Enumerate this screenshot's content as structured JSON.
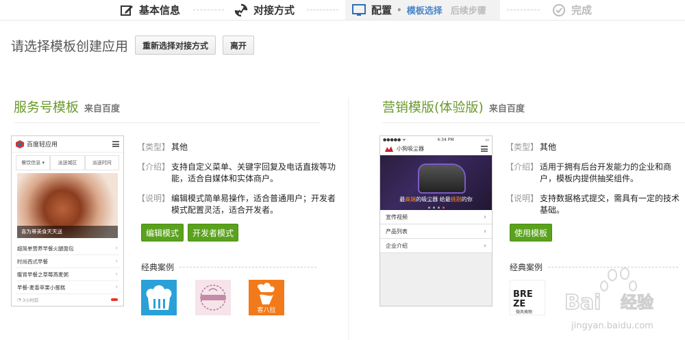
{
  "steps": {
    "s1": "基本信息",
    "s2": "对接方式",
    "s3": "配置",
    "s3_sub_active": "模板选择",
    "s3_sub_next": "后续步骤",
    "s4": "完成"
  },
  "toolbar": {
    "prompt": "请选择模板创建应用",
    "reselect_label": "重新选择对接方式",
    "leave_label": "离开"
  },
  "left": {
    "name": "服务号模板",
    "source": "来自百度",
    "phone": {
      "title": "百度轻应用",
      "tabs": [
        "餐饮信息 ▾",
        "派送城区",
        "派送时间"
      ],
      "hero_caption": "喜为尊美食天天送",
      "items": [
        "超简单营养早餐火腿面包",
        "时尚西式早餐",
        "暖胃早餐之草莓燕麦粥",
        "早餐-麦香苹果小蛋糕"
      ],
      "footer": "3小时前"
    },
    "type_label": "【类型】",
    "type_value": "其他",
    "intro_label": "【介绍】",
    "intro_value": "支持自定义菜单、关键字回复及电话直拨等功能，适合自媒体和实体商户。",
    "note_label": "【说明】",
    "note_value": "编辑模式简单易操作，适合普通用户；开发者模式配置灵活，适合开发者。",
    "edit_label": "编辑模式",
    "dev_label": "开发者模式",
    "cases_label": "经典案例",
    "case3_text": "客八拉"
  },
  "right": {
    "name": "营销模版(体验版)",
    "source": "来自百度",
    "phone": {
      "status_left": "●●●●● ᯤ",
      "status_time": "4:34 PM",
      "title": "小狗吸尘器",
      "hero_caption_a": "最",
      "hero_caption_b": "高端",
      "hero_caption_c": "的吸尘器 给最",
      "hero_caption_d": "挑剔",
      "hero_caption_e": "的你",
      "items": [
        "宣传视频",
        "产品列表",
        "企业介绍"
      ]
    },
    "type_label": "【类型】",
    "type_value": "其他",
    "intro_label": "【介绍】",
    "intro_value": "适用于拥有后台开发能力的企业和商户，模板内提供抽奖组件。",
    "note_label": "【说明】",
    "note_value": "支持数据格式提交，需具有一定的技术基础。",
    "use_label": "使用模板",
    "cases_label": "经典案例",
    "case_text_a": "BRE",
    "case_text_b": "ZE",
    "case_text_c": "微风格物"
  },
  "watermark": {
    "brand": "Bai",
    "brand2": "经验",
    "url": "jingyan.baidu.com"
  },
  "colors": {
    "accent_green": "#5aa21c",
    "title_green": "#6b9a2b",
    "step_blue": "#4a86c9"
  }
}
